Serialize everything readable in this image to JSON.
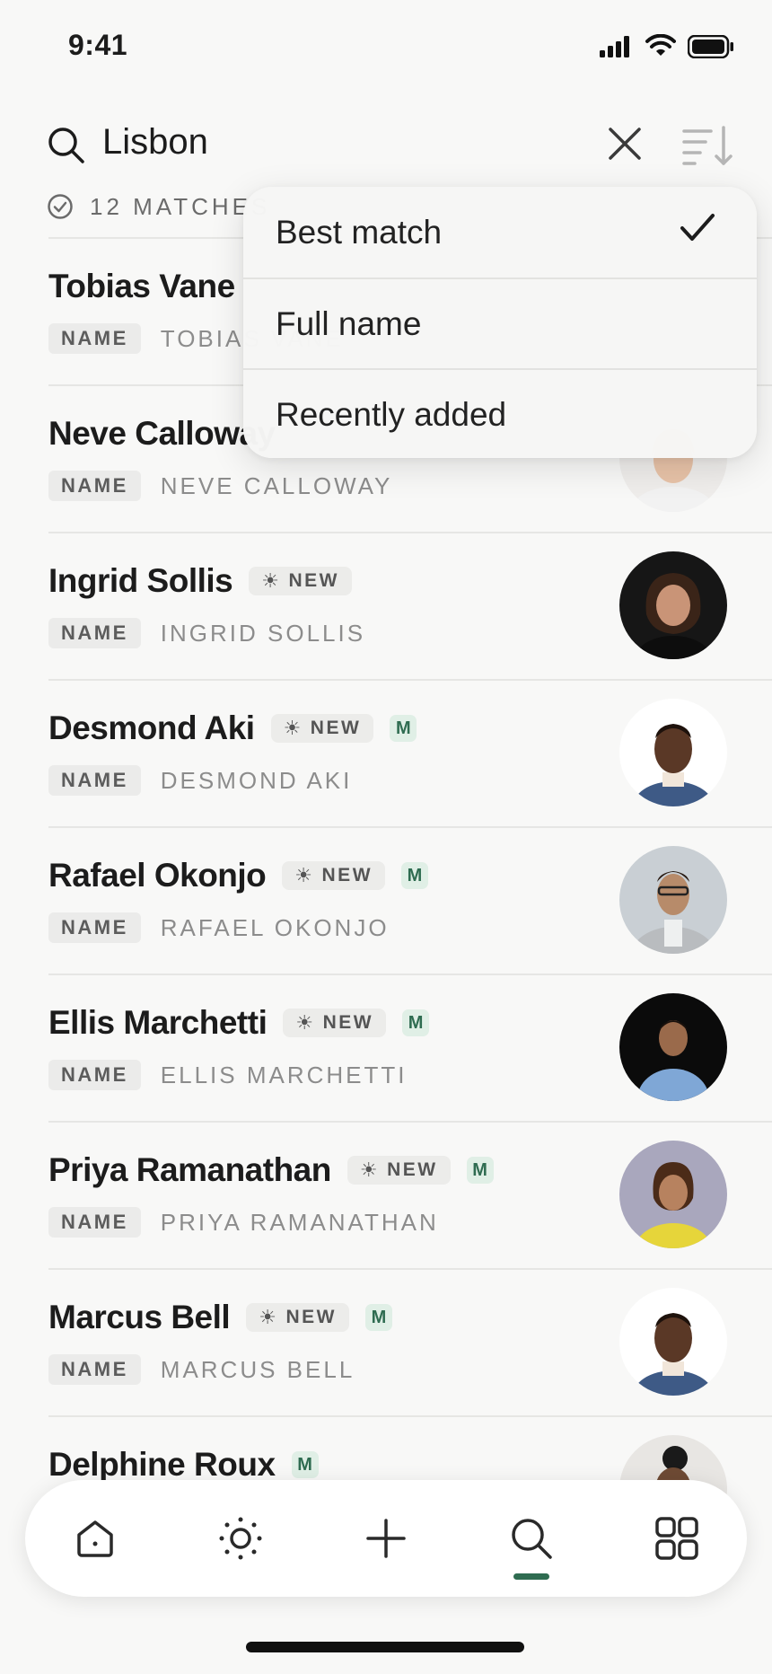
{
  "status": {
    "time": "9:41"
  },
  "search": {
    "query": "Lisbon"
  },
  "matches": {
    "label": "12 MATCHES"
  },
  "sort_menu": {
    "items": [
      {
        "label": "Best match",
        "selected": true
      },
      {
        "label": "Full name",
        "selected": false
      },
      {
        "label": "Recently added",
        "selected": false
      }
    ]
  },
  "list": {
    "tag_label": "NAME",
    "new_label": "NEW",
    "m_label": "M",
    "rows": [
      {
        "name": "Tobias Vane",
        "sub": "TOBIAS VANE",
        "new": false,
        "m": false
      },
      {
        "name": "Neve Calloway",
        "sub": "NEVE CALLOWAY",
        "new": false,
        "m": false
      },
      {
        "name": "Ingrid Sollis",
        "sub": "INGRID SOLLIS",
        "new": true,
        "m": false
      },
      {
        "name": "Desmond Aki",
        "sub": "DESMOND AKI",
        "new": true,
        "m": true
      },
      {
        "name": "Rafael Okonjo",
        "sub": "RAFAEL OKONJO",
        "new": true,
        "m": true
      },
      {
        "name": "Ellis Marchetti",
        "sub": "ELLIS MARCHETTI",
        "new": true,
        "m": true
      },
      {
        "name": "Priya Ramanathan",
        "sub": "PRIYA RAMANATHAN",
        "new": true,
        "m": true
      },
      {
        "name": "Marcus Bell",
        "sub": "MARCUS BELL",
        "new": true,
        "m": true
      },
      {
        "name": "Delphine Roux",
        "sub": "",
        "new": false,
        "m": true
      }
    ]
  },
  "tabbar": {
    "tabs": [
      "home-icon",
      "sun-icon",
      "plus-icon",
      "search-icon",
      "grid-icon"
    ],
    "active": "search-icon",
    "accent": "#2f6c51"
  }
}
